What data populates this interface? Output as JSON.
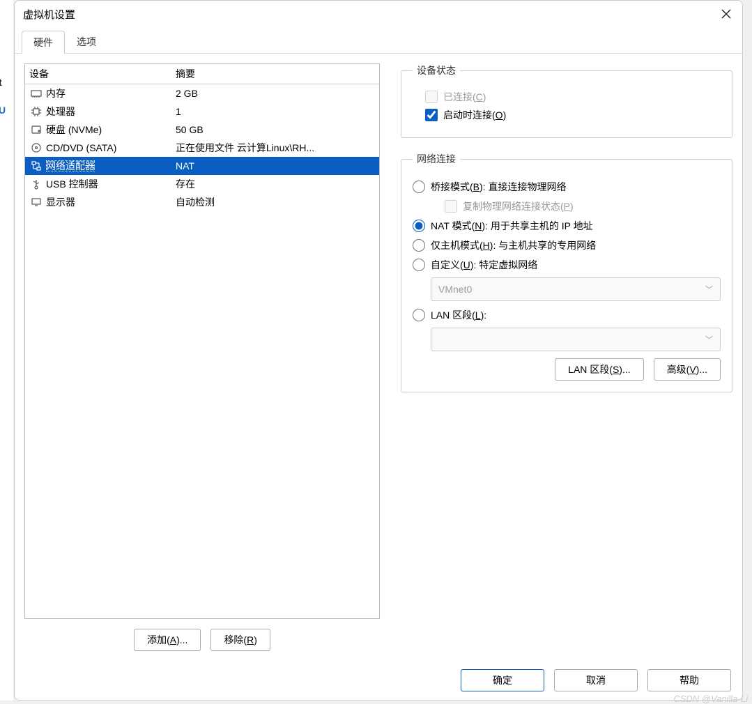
{
  "title": "虚拟机设置",
  "tabs": {
    "hardware": "硬件",
    "options": "选项"
  },
  "headers": {
    "device": "设备",
    "summary": "摘要"
  },
  "devices": {
    "memory": {
      "label": "内存",
      "summary": "2 GB"
    },
    "cpu": {
      "label": "处理器",
      "summary": "1"
    },
    "disk": {
      "label": "硬盘 (NVMe)",
      "summary": "50 GB"
    },
    "cddvd": {
      "label": "CD/DVD (SATA)",
      "summary": "正在使用文件 云计算Linux\\RH..."
    },
    "net": {
      "label": "网络适配器",
      "summary": "NAT"
    },
    "usb": {
      "label": "USB 控制器",
      "summary": "存在"
    },
    "display": {
      "label": "显示器",
      "summary": "自动检测"
    }
  },
  "buttons": {
    "add": "添加(A)...",
    "remove": "移除(R)",
    "lanseg": "LAN 区段(S)...",
    "advanced": "高级(V)...",
    "ok": "确定",
    "cancel": "取消",
    "help": "帮助"
  },
  "panel": {
    "status_legend": "设备状态",
    "connected": "已连接(C)",
    "connect_on_start": "启动时连接(O)",
    "net_legend": "网络连接",
    "bridged": "桥接模式(B): 直接连接物理网络",
    "replicate": "复制物理网络连接状态(P)",
    "nat": "NAT 模式(N): 用于共享主机的 IP 地址",
    "hostonly": "仅主机模式(H): 与主机共享的专用网络",
    "custom": "自定义(U): 特定虚拟网络",
    "vmnet_selected": "VMnet0",
    "lansegment": "LAN 区段(L):"
  },
  "watermark": "CSDN @Vanilla-Li"
}
